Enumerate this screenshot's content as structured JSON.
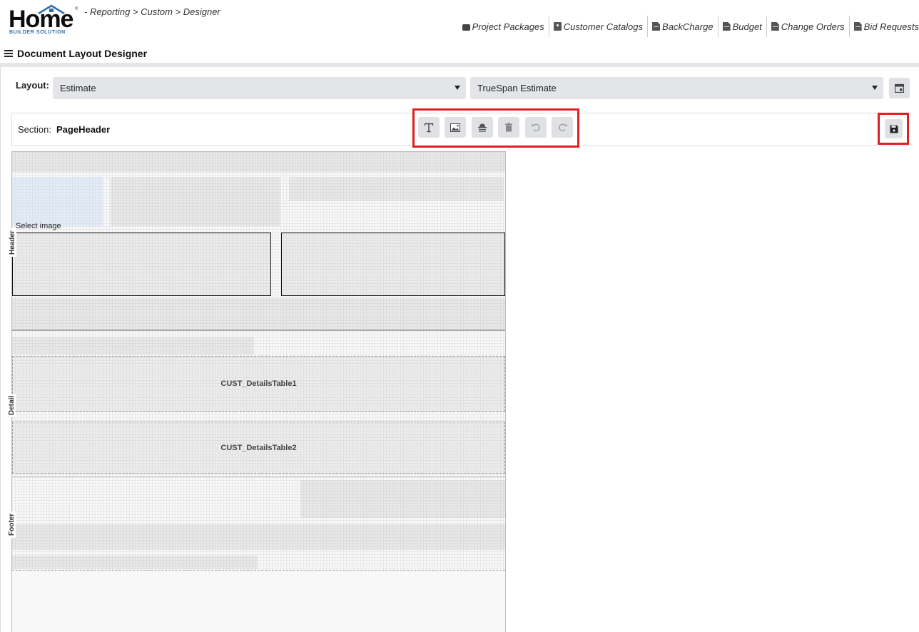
{
  "header": {
    "logo_word": "Home",
    "logo_sub": "BUILDER SOLUTION",
    "logo_reg": "®",
    "breadcrumb": "- Reporting > Custom > Designer"
  },
  "nav": [
    {
      "label": "Project Packages",
      "icon": "briefcase-icon"
    },
    {
      "label": "Customer Catalogs",
      "icon": "badge-icon"
    },
    {
      "label": "BackCharge",
      "icon": "document-icon"
    },
    {
      "label": "Budget",
      "icon": "document-icon"
    },
    {
      "label": "Change Orders",
      "icon": "document-icon"
    },
    {
      "label": "Bid Requests",
      "icon": "document-icon"
    }
  ],
  "page": {
    "title": "Document Layout Designer"
  },
  "layout": {
    "label": "Layout:",
    "type_value": "Estimate",
    "template_value": "TrueSpan Estimate"
  },
  "section": {
    "label": "Section:",
    "value": "PageHeader"
  },
  "toolbar": {
    "buttons": [
      "add-text",
      "add-image",
      "add-field",
      "delete",
      "undo",
      "redo"
    ],
    "highlight_color": "#e02020"
  },
  "canvas": {
    "bands": [
      "Header",
      "Detail",
      "Footer"
    ],
    "select_image_text": "Select image",
    "tables": [
      "CUST_DetailsTable1",
      "CUST_DetailsTable2"
    ]
  }
}
